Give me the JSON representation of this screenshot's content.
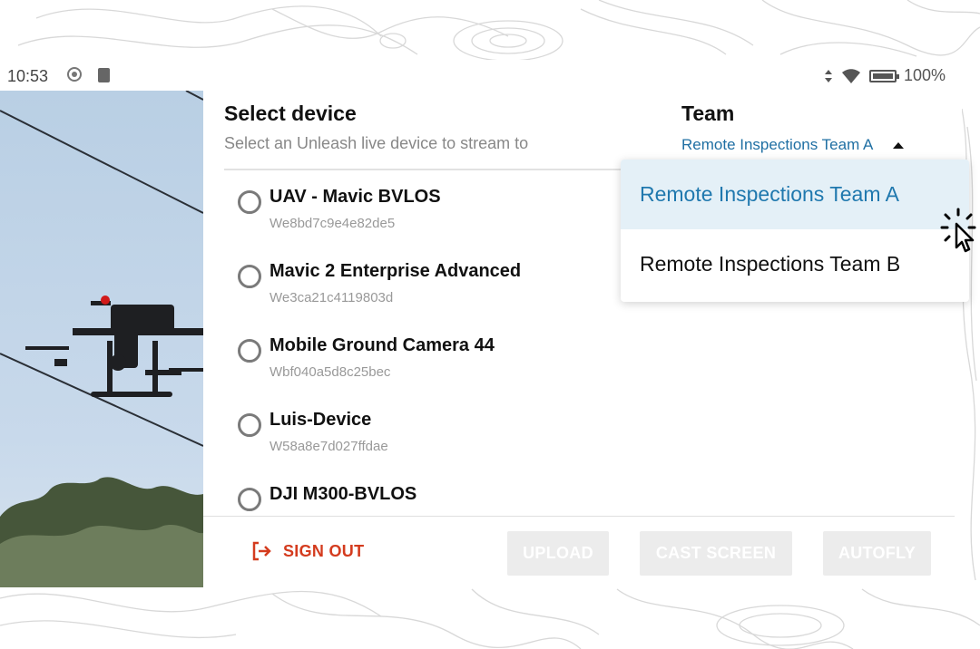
{
  "status_bar": {
    "time": "10:53",
    "battery": "100%",
    "icons": [
      "record-icon",
      "sd-card-icon",
      "data-arrows-icon",
      "wifi-icon",
      "battery-icon"
    ]
  },
  "panel": {
    "title": "Select device",
    "subtitle": "Select an Unleash live device to stream to",
    "team_heading": "Team",
    "team_selected": "Remote Inspections Team A"
  },
  "devices": [
    {
      "name": "UAV - Mavic BVLOS",
      "id": "We8bd7c9e4e82de5"
    },
    {
      "name": "Mavic 2 Enterprise Advanced",
      "id": "We3ca21c4119803d"
    },
    {
      "name": "Mobile Ground Camera 44",
      "id": "Wbf040a5d8c25bec"
    },
    {
      "name": "Luis-Device",
      "id": "W58a8e7d027ffdae"
    },
    {
      "name": "DJI M300-BVLOS",
      "id": ""
    }
  ],
  "footer": {
    "sign_out": "SIGN OUT",
    "upload": "UPLOAD",
    "cast_screen": "CAST SCREEN",
    "autofly": "AUTOFLY"
  },
  "team_dropdown": {
    "options": [
      "Remote Inspections Team A",
      "Remote Inspections Team B"
    ],
    "selected_index": 0
  },
  "colors": {
    "accent": "#1f78ae",
    "sign_out": "#d43b1e",
    "selected_bg": "#e4f0f7",
    "disabled_button": "#ececec"
  }
}
